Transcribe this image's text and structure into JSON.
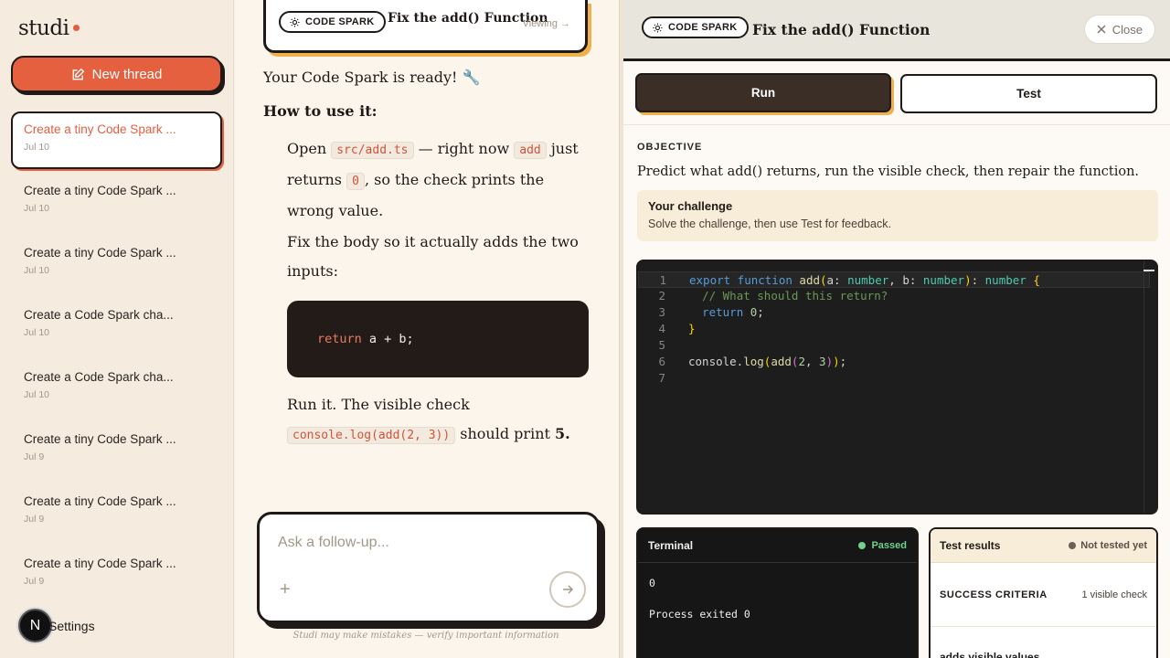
{
  "sidebar": {
    "logo": "studi",
    "new_thread_label": "New thread",
    "threads": [
      {
        "title": "Create a tiny Code Spark ...",
        "date": "Jul 10"
      },
      {
        "title": "Create a tiny Code Spark ...",
        "date": "Jul 10"
      },
      {
        "title": "Create a tiny Code Spark ...",
        "date": "Jul 10"
      },
      {
        "title": "Create a Code Spark cha...",
        "date": "Jul 10"
      },
      {
        "title": "Create a Code Spark cha...",
        "date": "Jul 10"
      },
      {
        "title": "Create a tiny Code Spark ...",
        "date": "Jul 9"
      },
      {
        "title": "Create a tiny Code Spark ...",
        "date": "Jul 9"
      },
      {
        "title": "Create a tiny Code Spark ...",
        "date": "Jul 9"
      }
    ],
    "avatar_initial": "N",
    "settings_label": "Settings"
  },
  "chat": {
    "card_badge": "CODE SPARK",
    "card_title": "Fix the add() Function",
    "card_status": "Viewing →",
    "ready_text": "Your Code Spark is ready! 🔧",
    "howto_heading": "How to use it:",
    "step1_a": "Open",
    "step1_file": "src/add.ts",
    "step1_b": "— right now",
    "step1_fn": "add",
    "step1_c": "just returns",
    "step1_zero": "0",
    "step1_d": ", so the check prints the wrong value.",
    "step2": "Fix the body so it actually adds the two inputs:",
    "code_kw": "return",
    "code_rest": " a + b;",
    "step3_a": "Run it. The visible check",
    "step3_code": "console.log(add(2, 3))",
    "step3_b": "should print",
    "step3_val": "5.",
    "composer_placeholder": "Ask a follow-up...",
    "disclaimer": "Studi may make mistakes — verify important information"
  },
  "panel": {
    "badge": "CODE SPARK",
    "title": "Fix the add() Function",
    "close_label": "Close",
    "run_label": "Run",
    "test_label": "Test",
    "objective_label": "OBJECTIVE",
    "objective_text": "Predict what add() returns, run the visible check, then repair the function.",
    "challenge_title": "Your challenge",
    "challenge_text": "Solve the challenge, then use Test for feedback.",
    "editor_line_numbers": [
      "1",
      "2",
      "3",
      "4",
      "5",
      "6",
      "7"
    ],
    "terminal_title": "Terminal",
    "terminal_status": "Passed",
    "terminal_output_1": "0",
    "terminal_output_2": "Process exited 0",
    "tests_title": "Test results",
    "tests_status": "Not tested yet",
    "criteria_label": "SUCCESS CRITERIA",
    "criteria_count": "1 visible check",
    "check_item": "adds visible values"
  },
  "colors": {
    "accent": "#e5603e",
    "highlight": "#f0b04a",
    "ink": "#1f1a17",
    "passed": "#6fd28d"
  }
}
